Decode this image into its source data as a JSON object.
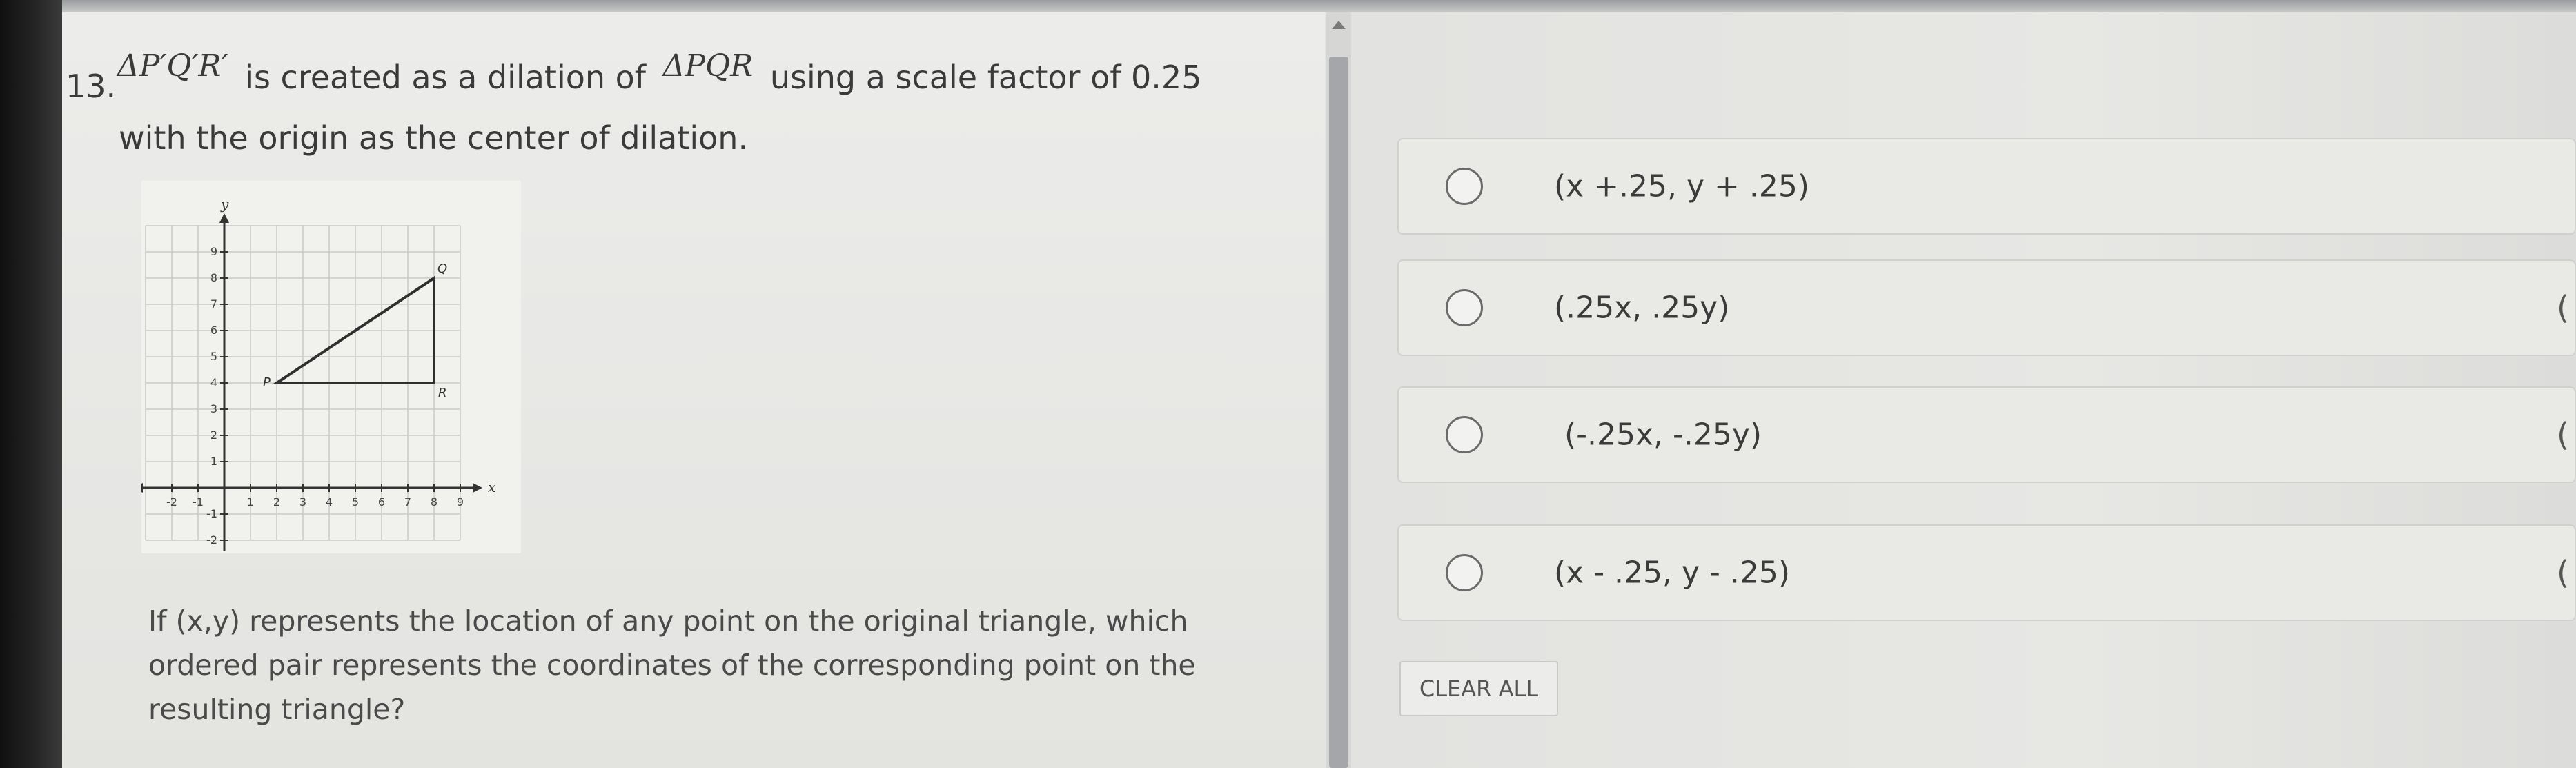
{
  "question": {
    "number": "13.",
    "image_triangle": "ΔP′Q′R′",
    "text_created": "is created as a dilation of",
    "original_triangle": "ΔPQR",
    "text_scale": "using a scale factor of 0.25",
    "line2": "with the origin as the center of dilation.",
    "followup": "If (x,y) represents the location of any point on the original triangle, which ordered pair represents the coordinates of the corresponding point on the resulting triangle?"
  },
  "graph": {
    "x_axis_label": "x",
    "y_axis_label": "y",
    "x_ticks": [
      "-2",
      "-1",
      "1",
      "2",
      "3",
      "4",
      "5",
      "6",
      "7",
      "8",
      "9"
    ],
    "y_ticks": [
      "-2",
      "-1",
      "1",
      "2",
      "3",
      "4",
      "5",
      "6",
      "7",
      "8",
      "9"
    ],
    "points": {
      "P": {
        "label": "P",
        "x": 2,
        "y": 4
      },
      "Q": {
        "label": "Q",
        "x": 8,
        "y": 8
      },
      "R": {
        "label": "R",
        "x": 8,
        "y": 4
      }
    }
  },
  "choices": [
    {
      "label": "(x +.25, y + .25)"
    },
    {
      "label": "(.25x, .25y)"
    },
    {
      "label": "(-.25x, -.25y)"
    },
    {
      "label": "(x - .25, y -  .25)"
    }
  ],
  "clear_all_label": "CLEAR ALL",
  "colors": {
    "radio_border": "#6b6b6b",
    "triangle_stroke": "#2f2f2f",
    "grid": "#c9c9c9"
  }
}
